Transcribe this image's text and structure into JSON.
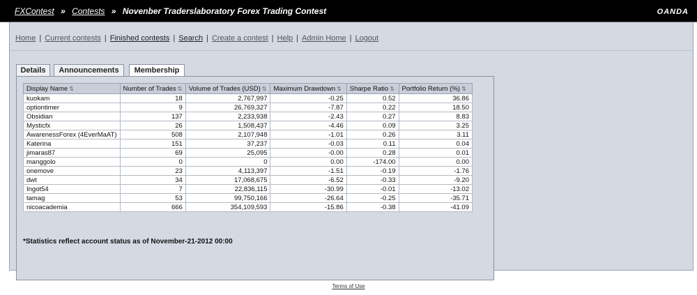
{
  "breadcrumb": {
    "root": "FXContest",
    "sep1": "»",
    "contests": "Contests",
    "sep2": "»",
    "current": "Novenber Traderslaboratory Forex Trading Contest"
  },
  "brand": "OANDA",
  "nav": [
    {
      "label": "Home"
    },
    {
      "label": "Current contests"
    },
    {
      "label": "Finished contests"
    },
    {
      "label": "Search"
    },
    {
      "label": "Create a contest"
    },
    {
      "label": "Help"
    },
    {
      "label": "Admin Home"
    },
    {
      "label": "Logout"
    }
  ],
  "nav_separator": "|",
  "tabs": [
    {
      "label": "Details"
    },
    {
      "label": "Announcements"
    },
    {
      "label": "Membership"
    }
  ],
  "sort_glyph": "⇅",
  "table": {
    "columns": [
      "Display Name",
      "Number of Trades",
      "Volume of Trades (USD)",
      "Maximum Drawdown",
      "Sharpe Ratio",
      "Portfolio Return (%)"
    ],
    "rows": [
      [
        "kuokam",
        "18",
        "2,767,997",
        "-0.25",
        "0.52",
        "36.86"
      ],
      [
        "optiontimer",
        "9",
        "26,769,327",
        "-7.87",
        "0.22",
        "18.50"
      ],
      [
        "Obsidian",
        "137",
        "2,233,938",
        "-2.43",
        "0.27",
        "8.83"
      ],
      [
        "Mysticfx",
        "26",
        "1,508,437",
        "-4.46",
        "0.09",
        "3.25"
      ],
      [
        "AwarenessForex (4EverMaAT)",
        "508",
        "2,107,948",
        "-1.01",
        "0.26",
        "3.11"
      ],
      [
        "Katerina",
        "151",
        "37,237",
        "-0.03",
        "0.11",
        "0.04"
      ],
      [
        "jimaras87",
        "69",
        "25,095",
        "-0.00",
        "0.28",
        "0.01"
      ],
      [
        "manggolo",
        "0",
        "0",
        "0.00",
        "-174.00",
        "0.00"
      ],
      [
        "onemove",
        "23",
        "4,113,397",
        "-1.51",
        "-0.19",
        "-1.76"
      ],
      [
        "dwt",
        "34",
        "17,068,675",
        "-6.52",
        "-0.33",
        "-9.20"
      ],
      [
        "Ingot54",
        "7",
        "22,836,115",
        "-30.99",
        "-0.01",
        "-13.02"
      ],
      [
        "tamag",
        "53",
        "99,750,166",
        "-26.64",
        "-0.25",
        "-35.71"
      ],
      [
        "nicoacademia",
        "666",
        "354,109,593",
        "-15.86",
        "-0.38",
        "-41.09"
      ]
    ]
  },
  "note": "*Statistics reflect account status as of November-21-2012 00:00",
  "footer": {
    "terms": "Terms of Use"
  }
}
